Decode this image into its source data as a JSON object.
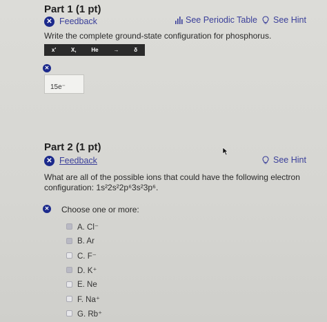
{
  "part1": {
    "title": "Part 1 (1 pt)",
    "feedback_label": "Feedback",
    "periodic_table_label": "See Periodic Table",
    "hint_label": "See Hint",
    "question": "Write the complete ground-state configuration for phosphorus.",
    "toolbar": [
      "x'",
      "X,",
      "He",
      "→",
      "δ"
    ],
    "answer_value": "15e⁻"
  },
  "part2": {
    "title": "Part 2 (1 pt)",
    "feedback_label": "Feedback",
    "hint_label": "See Hint",
    "question_line1": "What are all of the possible ions that could have the following electron",
    "question_line2_prefix": "configuration: ",
    "configuration": "1s²2s²2p⁶3s²3p⁶.",
    "choose_label": "Choose one or more:",
    "options": [
      {
        "label": "A. Cl⁻",
        "checked": true
      },
      {
        "label": "B. Ar",
        "checked": true
      },
      {
        "label": "C. F⁻",
        "checked": false
      },
      {
        "label": "D. K⁺",
        "checked": true
      },
      {
        "label": "E. Ne",
        "checked": false
      },
      {
        "label": "F. Na⁺",
        "checked": false
      },
      {
        "label": "G. Rb⁺",
        "checked": false
      }
    ]
  },
  "colors": {
    "badge": "#1c2a8c",
    "link": "#3a3f9a",
    "toolbar": "#2b2b2b"
  },
  "icons": {
    "incorrect": "x-circle-icon",
    "periodic_table": "bar-chart-icon",
    "hint": "lightbulb-icon"
  }
}
